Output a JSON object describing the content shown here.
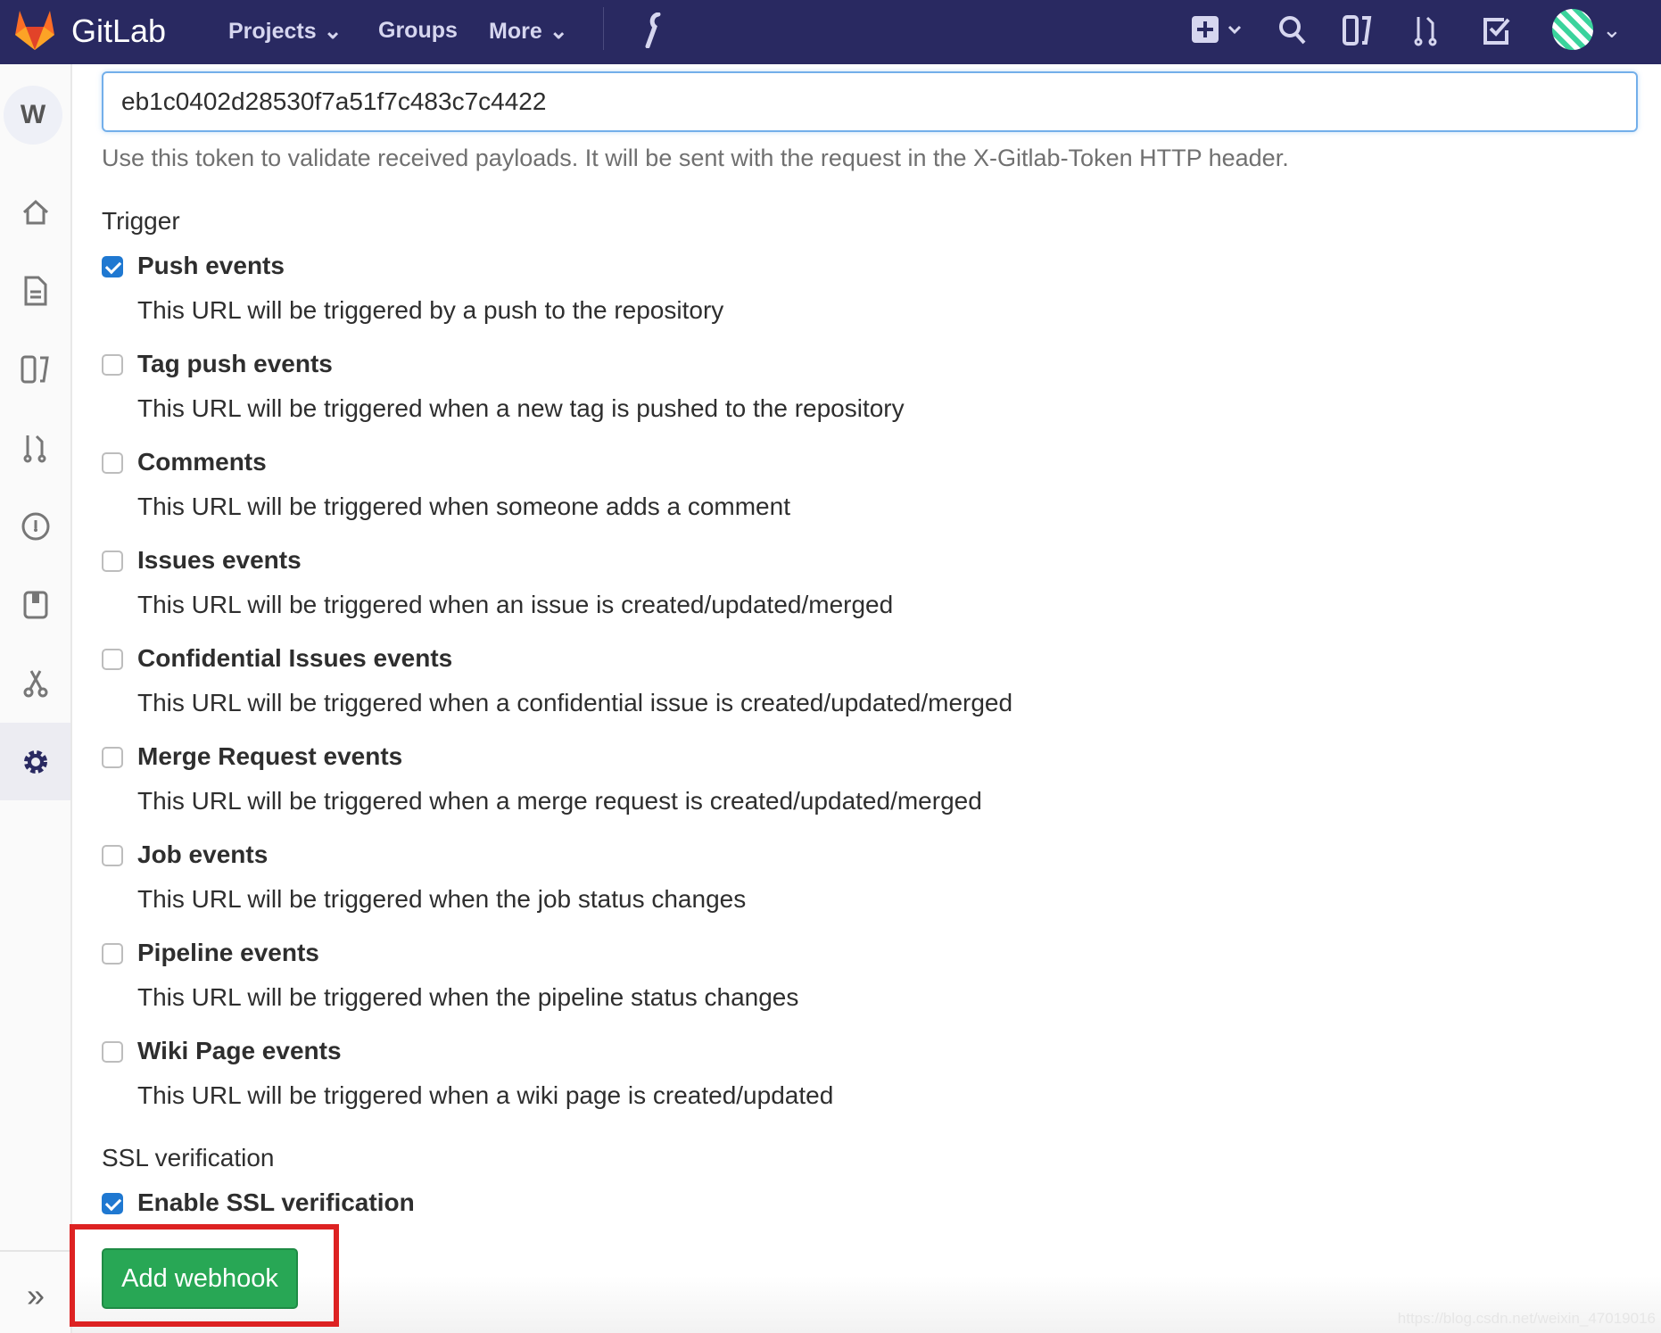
{
  "topbar": {
    "brand": "GitLab",
    "nav": [
      {
        "label": "Projects",
        "icon": "chevron-down-icon"
      },
      {
        "label": "Groups"
      },
      {
        "label": "More",
        "icon": "chevron-down-icon"
      }
    ],
    "icons": [
      "wrench-icon",
      "plus-square-icon",
      "search-icon",
      "issues-icon",
      "merge-request-icon",
      "todo-icon",
      "user-avatar"
    ]
  },
  "sidebar": {
    "avatar_letter": "W",
    "items": [
      "home-icon",
      "document-icon",
      "issues-board-icon",
      "merge-request-icon",
      "gauge-icon",
      "snippet-icon",
      "scissors-icon",
      "settings-icon"
    ],
    "active": "settings-icon",
    "collapse_icon": "double-chevron-right-icon"
  },
  "form": {
    "secret_token_value": "eb1c0402d28530f7a51f7c483c7c4422",
    "secret_token_help": "Use this token to validate received payloads. It will be sent with the request in the X-Gitlab-Token HTTP header.",
    "trigger_heading": "Trigger",
    "triggers": [
      {
        "label": "Push events",
        "desc": "This URL will be triggered by a push to the repository",
        "checked": true
      },
      {
        "label": "Tag push events",
        "desc": "This URL will be triggered when a new tag is pushed to the repository",
        "checked": false
      },
      {
        "label": "Comments",
        "desc": "This URL will be triggered when someone adds a comment",
        "checked": false
      },
      {
        "label": "Issues events",
        "desc": "This URL will be triggered when an issue is created/updated/merged",
        "checked": false
      },
      {
        "label": "Confidential Issues events",
        "desc": "This URL will be triggered when a confidential issue is created/updated/merged",
        "checked": false
      },
      {
        "label": "Merge Request events",
        "desc": "This URL will be triggered when a merge request is created/updated/merged",
        "checked": false
      },
      {
        "label": "Job events",
        "desc": "This URL will be triggered when the job status changes",
        "checked": false
      },
      {
        "label": "Pipeline events",
        "desc": "This URL will be triggered when the pipeline status changes",
        "checked": false
      },
      {
        "label": "Wiki Page events",
        "desc": "This URL will be triggered when a wiki page is created/updated",
        "checked": false
      }
    ],
    "ssl_heading": "SSL verification",
    "ssl_label": "Enable SSL verification",
    "ssl_checked": true,
    "submit_label": "Add webhook"
  },
  "watermark": "https://blog.csdn.net/weixin_47019016",
  "colors": {
    "topbar": "#292961",
    "accent": "#1f78d1",
    "submit": "#28a755",
    "highlight": "#dd2222"
  }
}
